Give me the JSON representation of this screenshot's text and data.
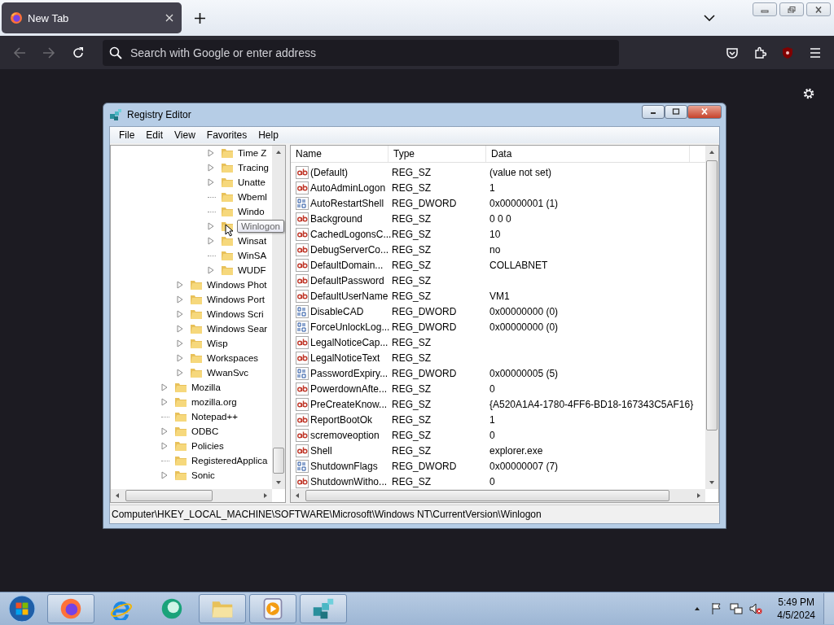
{
  "browser": {
    "tabs": [
      {
        "title": "New Tab",
        "selected": true
      }
    ],
    "toolbar": {
      "back_disabled": true,
      "forward_disabled": true,
      "search": {
        "placeholder": "Search with Google or enter address"
      }
    }
  },
  "registry_editor": {
    "title": "Registry Editor",
    "menu": [
      "File",
      "Edit",
      "View",
      "Favorites",
      "Help"
    ],
    "tree": {
      "items": [
        {
          "children": [
            {
              "children": [
                {
                  "children": [
                    {
                      "label": "Time Z",
                      "expandable": true,
                      "selected": false
                    },
                    {
                      "label": "Tracing",
                      "expandable": true,
                      "selected": false
                    },
                    {
                      "label": "Unatte",
                      "expandable": true,
                      "selected": false
                    },
                    {
                      "label": "Wbeml",
                      "expandable": false,
                      "selected": false
                    },
                    {
                      "label": "Windo",
                      "expandable": false,
                      "selected": false
                    },
                    {
                      "label": "Winlogon",
                      "expandable": true,
                      "selected": true,
                      "tooltip": true
                    },
                    {
                      "label": "Winsat",
                      "expandable": true,
                      "selected": false
                    },
                    {
                      "label": "WinSA",
                      "expandable": false,
                      "selected": false
                    },
                    {
                      "label": "WUDF",
                      "expandable": true,
                      "selected": false
                    }
                  ]
                }
              ]
            },
            {
              "label": "Windows Phot",
              "expandable": true,
              "selected": false
            },
            {
              "label": "Windows Port",
              "expandable": true,
              "selected": false
            },
            {
              "label": "Windows Scri",
              "expandable": true,
              "selected": false
            },
            {
              "label": "Windows Sear",
              "expandable": true,
              "selected": false
            },
            {
              "label": "Wisp",
              "expandable": true,
              "selected": false
            },
            {
              "label": "Workspaces",
              "expandable": true,
              "selected": false
            },
            {
              "label": "WwanSvc",
              "expandable": true,
              "selected": false
            }
          ]
        },
        {
          "label": "Mozilla",
          "expandable": true,
          "selected": false
        },
        {
          "label": "mozilla.org",
          "expandable": true,
          "selected": false
        },
        {
          "label": "Notepad++",
          "expandable": false,
          "selected": false
        },
        {
          "label": "ODBC",
          "expandable": true,
          "selected": false
        },
        {
          "label": "Policies",
          "expandable": true,
          "selected": false
        },
        {
          "label": "RegisteredApplica",
          "expandable": false,
          "selected": false
        },
        {
          "label": "Sonic",
          "expandable": true,
          "selected": false
        }
      ]
    },
    "columns": [
      "Name",
      "Type",
      "Data"
    ],
    "rows": [
      {
        "kind": "string",
        "name": "(Default)",
        "type": "REG_SZ",
        "data": "(value not set)"
      },
      {
        "kind": "string",
        "name": "AutoAdminLogon",
        "type": "REG_SZ",
        "data": "1"
      },
      {
        "kind": "number",
        "name": "AutoRestartShell",
        "type": "REG_DWORD",
        "data": "0x00000001 (1)"
      },
      {
        "kind": "string",
        "name": "Background",
        "type": "REG_SZ",
        "data": "0 0 0"
      },
      {
        "kind": "string",
        "name": "CachedLogonsC...",
        "type": "REG_SZ",
        "data": "10"
      },
      {
        "kind": "string",
        "name": "DebugServerCo...",
        "type": "REG_SZ",
        "data": "no"
      },
      {
        "kind": "string",
        "name": "DefaultDomain...",
        "type": "REG_SZ",
        "data": "COLLABNET"
      },
      {
        "kind": "string",
        "name": "DefaultPassword",
        "type": "REG_SZ"
      },
      {
        "kind": "string",
        "name": "DefaultUserName",
        "type": "REG_SZ",
        "data": "VM1"
      },
      {
        "kind": "number",
        "name": "DisableCAD",
        "type": "REG_DWORD",
        "data": "0x00000000 (0)"
      },
      {
        "kind": "number",
        "name": "ForceUnlockLog...",
        "type": "REG_DWORD",
        "data": "0x00000000 (0)"
      },
      {
        "kind": "string",
        "name": "LegalNoticeCap...",
        "type": "REG_SZ"
      },
      {
        "kind": "string",
        "name": "LegalNoticeText",
        "type": "REG_SZ"
      },
      {
        "kind": "number",
        "name": "PasswordExpiry...",
        "type": "REG_DWORD",
        "data": "0x00000005 (5)"
      },
      {
        "kind": "string",
        "name": "PowerdownAfte...",
        "type": "REG_SZ",
        "data": "0"
      },
      {
        "kind": "string",
        "name": "PreCreateKnow...",
        "type": "REG_SZ",
        "data": "{A520A1A4-1780-4FF6-BD18-167343C5AF16}"
      },
      {
        "kind": "string",
        "name": "ReportBootOk",
        "type": "REG_SZ",
        "data": "1"
      },
      {
        "kind": "string",
        "name": "scremoveoption",
        "type": "REG_SZ",
        "data": "0"
      },
      {
        "kind": "string",
        "name": "Shell",
        "type": "REG_SZ",
        "data": "explorer.exe"
      },
      {
        "kind": "number",
        "name": "ShutdownFlags",
        "type": "REG_DWORD",
        "data": "0x00000007 (7)"
      },
      {
        "kind": "string",
        "name": "ShutdownWitho...",
        "type": "REG_SZ",
        "data": "0"
      }
    ],
    "status_bar": "Computer\\HKEY_LOCAL_MACHINE\\SOFTWARE\\Microsoft\\Windows NT\\CurrentVersion\\Winlogon"
  },
  "taskbar": {
    "apps": [
      {
        "kind": "firefox",
        "running": true
      },
      {
        "kind": "ie",
        "running": false
      },
      {
        "kind": "chat",
        "running": false
      },
      {
        "kind": "folder",
        "running": true
      },
      {
        "kind": "media",
        "running": true
      },
      {
        "kind": "regedit",
        "running": true
      }
    ],
    "clock": {
      "time": "5:49 PM",
      "date": "4/5/2024"
    }
  }
}
